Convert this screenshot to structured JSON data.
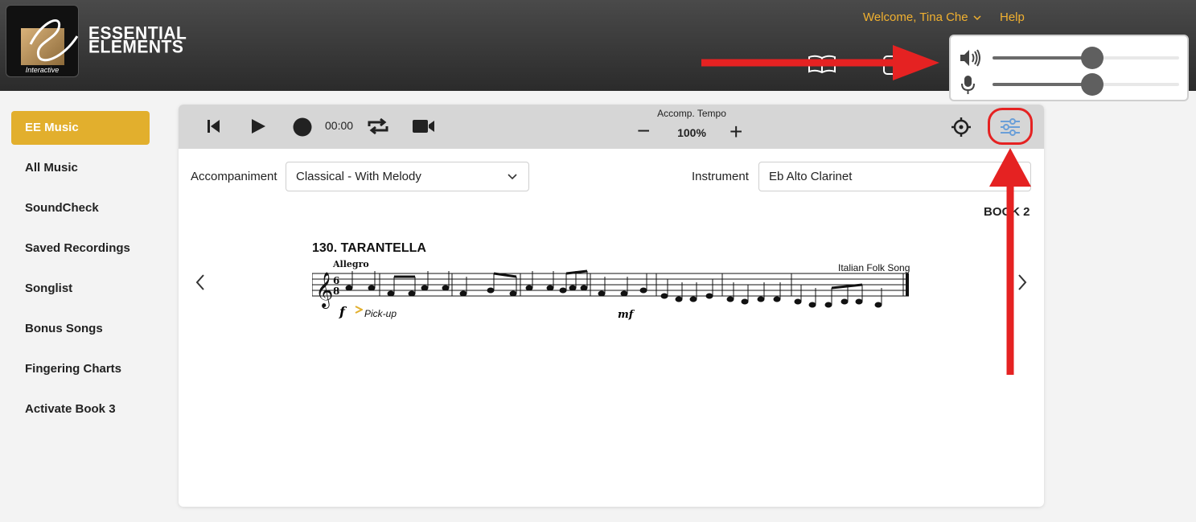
{
  "header": {
    "logo_line1": "ESSENTIAL",
    "logo_line2": "ELEMENTS",
    "logo_sub": "Interactive",
    "welcome": "Welcome, Tina Che",
    "help": "Help"
  },
  "audio_popup": {
    "speaker_icon": "speaker-icon",
    "mic_icon": "microphone-icon",
    "playback_volume": 0.55,
    "mic_volume": 0.55
  },
  "sidebar": {
    "items": [
      {
        "label": "EE Music",
        "active": true
      },
      {
        "label": "All Music"
      },
      {
        "label": "SoundCheck"
      },
      {
        "label": "Saved Recordings"
      },
      {
        "label": "Songlist"
      },
      {
        "label": "Bonus Songs"
      },
      {
        "label": "Fingering Charts"
      },
      {
        "label": "Activate Book 3"
      }
    ]
  },
  "toolbar": {
    "time": "00:00",
    "tempo_label": "Accomp. Tempo",
    "tempo_value": "100%",
    "minus": "−",
    "plus": "+"
  },
  "controls": {
    "accompaniment_label": "Accompaniment",
    "accompaniment_value": "Classical - With Melody",
    "instrument_label": "Instrument",
    "instrument_value": "Eb Alto Clarinet"
  },
  "sheet": {
    "book": "BOOK 2",
    "title": "130.  TARANTELLA",
    "tempo_mark": "Allegro",
    "composer": "Italian Folk Song",
    "dynamic_start": "f",
    "pickup": "Pick-up",
    "dynamic_mid": "mf"
  },
  "colors": {
    "accent": "#e2af2d",
    "header_text": "#f0b030",
    "annotation": "#e52222",
    "settings_icon": "#6a9fd8"
  }
}
